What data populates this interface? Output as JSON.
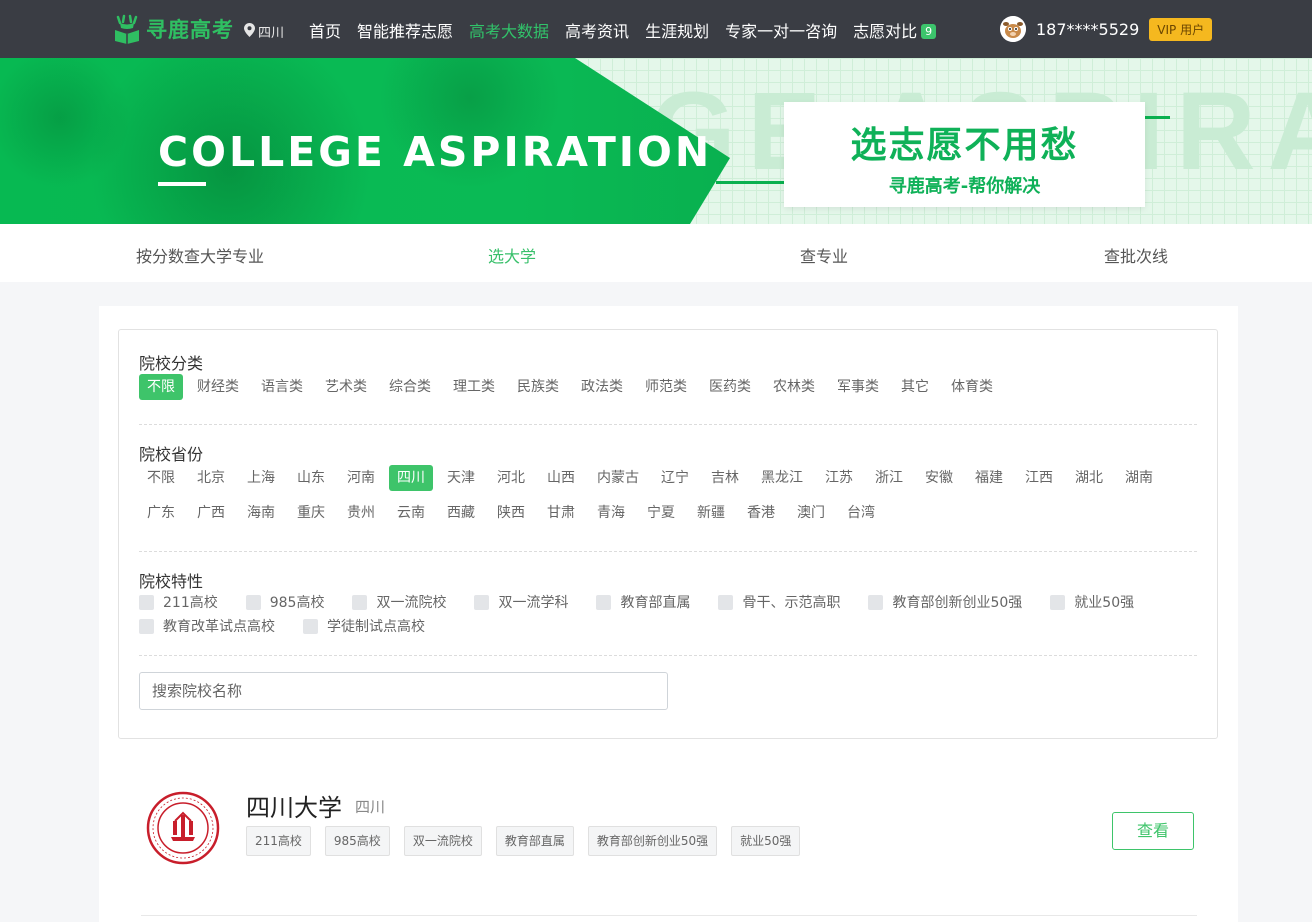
{
  "header": {
    "brand": "寻鹿高考",
    "location": "四川",
    "nav": [
      {
        "label": "首页",
        "active": false
      },
      {
        "label": "智能推荐志愿",
        "active": false
      },
      {
        "label": "高考大数据",
        "active": true
      },
      {
        "label": "高考资讯",
        "active": false
      },
      {
        "label": "生涯规划",
        "active": false
      },
      {
        "label": "专家一对一咨询",
        "active": false
      },
      {
        "label": "志愿对比",
        "active": false,
        "badge": "9"
      }
    ],
    "user_phone": "187****5529",
    "vip_label": "VIP 用户"
  },
  "banner": {
    "title": "COLLEGE ASPIRATION",
    "bg_text": "GE ASPIRAT",
    "slogan": "选志愿不用愁",
    "sub": "寻鹿高考-帮你解决"
  },
  "subtabs": [
    {
      "label": "按分数查大学专业",
      "active": false
    },
    {
      "label": "选大学",
      "active": true
    },
    {
      "label": "查专业",
      "active": false
    },
    {
      "label": "查批次线",
      "active": false
    }
  ],
  "filters": {
    "category": {
      "title": "院校分类",
      "options": [
        "不限",
        "财经类",
        "语言类",
        "艺术类",
        "综合类",
        "理工类",
        "民族类",
        "政法类",
        "师范类",
        "医药类",
        "农林类",
        "军事类",
        "其它",
        "体育类"
      ],
      "selected": "不限"
    },
    "province": {
      "title": "院校省份",
      "options": [
        "不限",
        "北京",
        "上海",
        "山东",
        "河南",
        "四川",
        "天津",
        "河北",
        "山西",
        "内蒙古",
        "辽宁",
        "吉林",
        "黑龙江",
        "江苏",
        "浙江",
        "安徽",
        "福建",
        "江西",
        "湖北",
        "湖南",
        "广东",
        "广西",
        "海南",
        "重庆",
        "贵州",
        "云南",
        "西藏",
        "陕西",
        "甘肃",
        "青海",
        "宁夏",
        "新疆",
        "香港",
        "澳门",
        "台湾"
      ],
      "selected": "四川"
    },
    "features": {
      "title": "院校特性",
      "options": [
        "211高校",
        "985高校",
        "双一流院校",
        "双一流学科",
        "教育部直属",
        "骨干、示范高职",
        "教育部创新创业50强",
        "就业50强",
        "教育改革试点高校",
        "学徒制试点高校"
      ]
    },
    "search_placeholder": "搜索院校名称"
  },
  "schools": [
    {
      "name": "四川大学",
      "province": "四川",
      "tags": [
        "211高校",
        "985高校",
        "双一流院校",
        "教育部直属",
        "教育部创新创业50强",
        "就业50强"
      ],
      "button": "查看"
    }
  ],
  "colors": {
    "topbar": "#3a3d44",
    "accent": "#3ec46a",
    "vip": "#f5b81f",
    "school_red": "#c81e2b"
  }
}
